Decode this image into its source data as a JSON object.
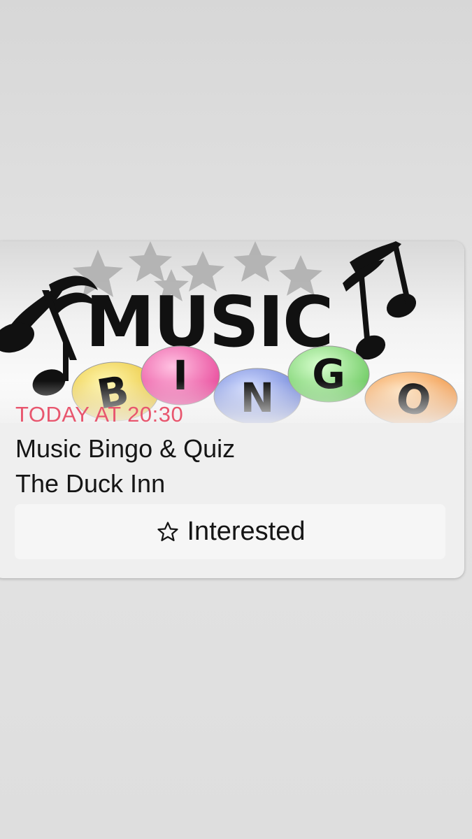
{
  "banner": {
    "word_top": "MUSIC",
    "word_bottom_letters": [
      "B",
      "I",
      "N",
      "G",
      "O"
    ],
    "ball_colors": [
      "#f0d44c",
      "#ee5fa8",
      "#7c8ee0",
      "#86d67a",
      "#f4a95a"
    ]
  },
  "event": {
    "time": "TODAY AT 20:30",
    "title": "Music Bingo & Quiz",
    "venue": "The Duck Inn"
  },
  "actions": {
    "interested_label": "Interested",
    "interested_icon": "star-outline-icon"
  }
}
